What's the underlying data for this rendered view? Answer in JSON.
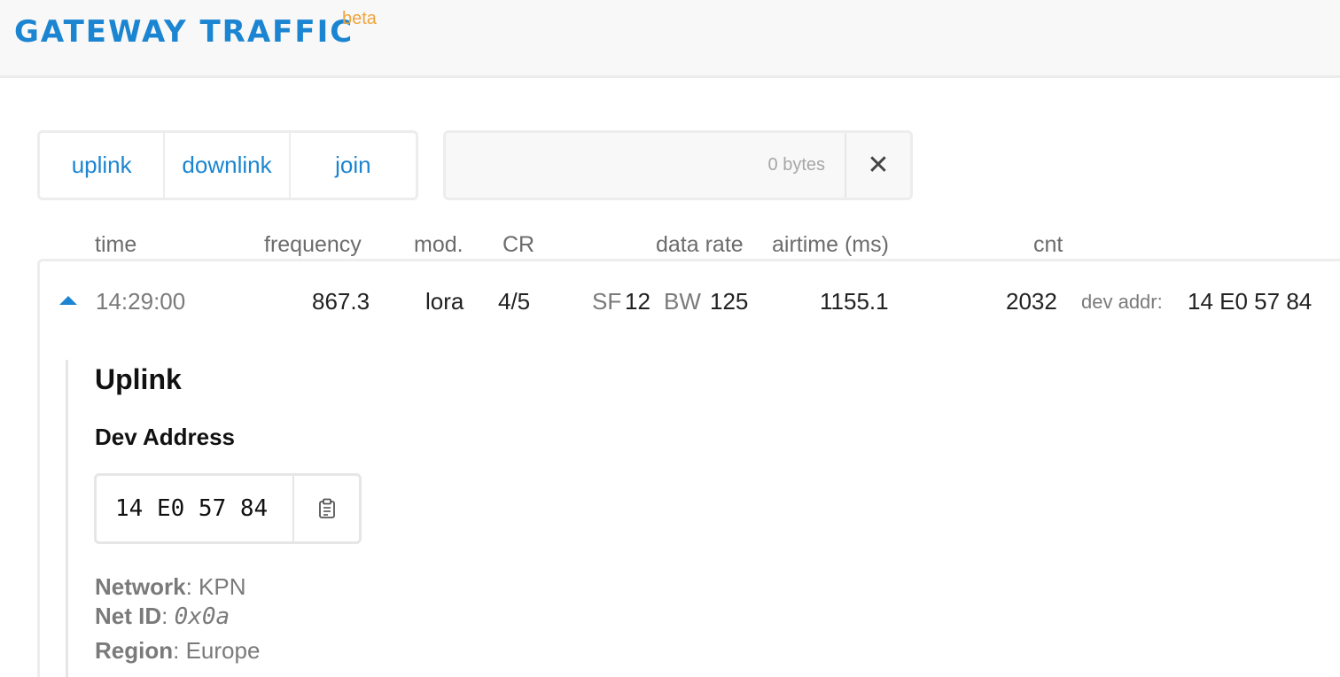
{
  "header": {
    "title": "GATEWAY TRAFFIC",
    "badge": "beta"
  },
  "filters": {
    "uplink": "uplink",
    "downlink": "downlink",
    "join": "join"
  },
  "search": {
    "byte_count": "0 bytes",
    "clear_icon": "close-icon",
    "clear_glyph": "✕"
  },
  "columns": {
    "time": "time",
    "frequency": "frequency",
    "mod": "mod.",
    "cr": "CR",
    "data_rate": "data rate",
    "airtime": "airtime (ms)",
    "cnt": "cnt"
  },
  "row": {
    "expand_icon": "caret-up-icon",
    "time": "14:29:00",
    "frequency": "867.3",
    "modulation": "lora",
    "cr": "4/5",
    "sf_label": "SF",
    "sf_value": "12",
    "bw_label": "BW",
    "bw_value": "125",
    "airtime": "1155.1",
    "cnt": "2032",
    "dev_addr_label": "dev addr:",
    "dev_addr": "14 E0 57 84"
  },
  "detail": {
    "heading": "Uplink",
    "dev_address_heading": "Dev Address",
    "dev_address_value": "14 E0 57 84",
    "copy_icon": "clipboard-icon",
    "network_label": "Network",
    "network_value": "KPN",
    "net_id_label": "Net ID",
    "net_id_value": "0x0a",
    "region_label": "Region",
    "region_value": "Europe",
    "separator": ": "
  },
  "colors": {
    "accent": "#1b85d1",
    "badge": "#f0a43b",
    "muted": "#7a7a7a",
    "border": "#ededed"
  }
}
